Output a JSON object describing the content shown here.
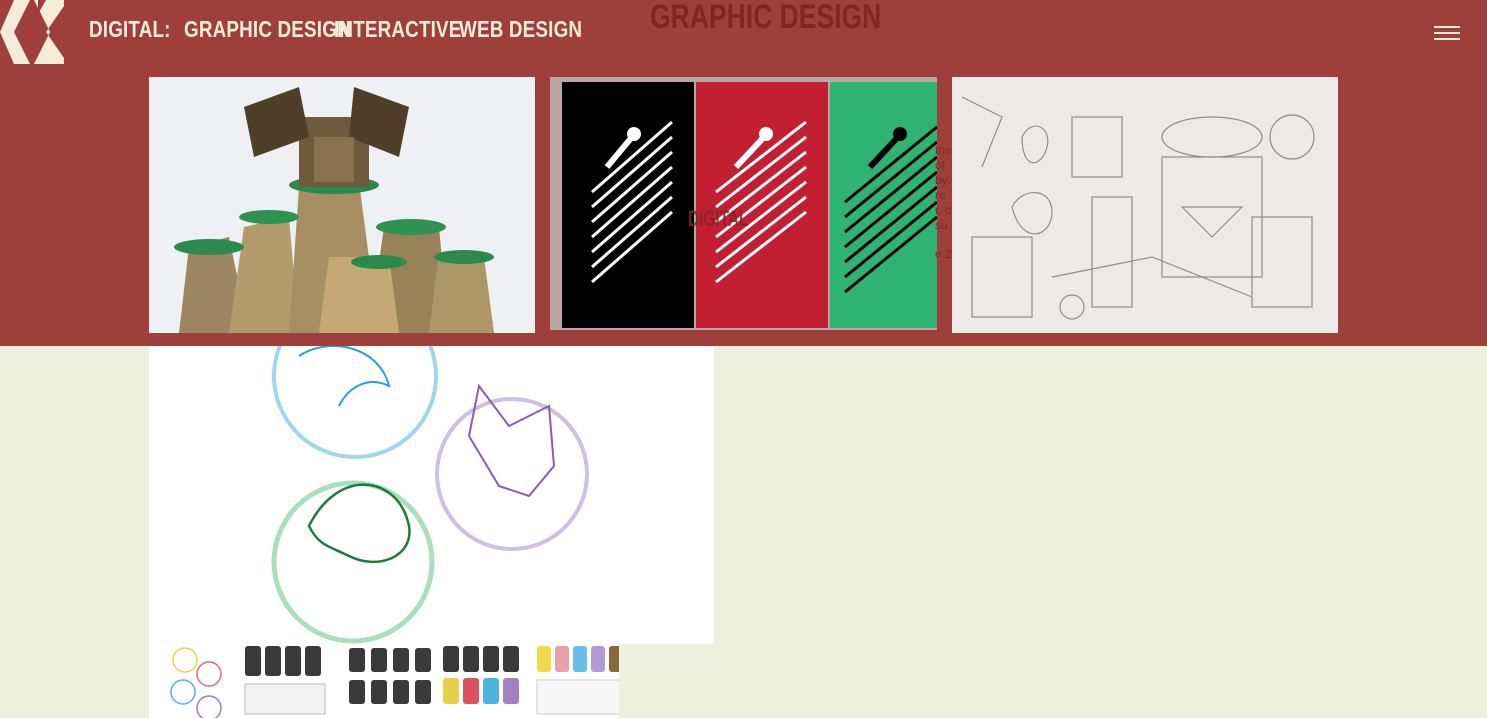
{
  "nav": {
    "section_label": "DIGITAL:",
    "items": [
      "GRAPHIC DESIGN",
      "INTERACTIVE",
      "WEB DESIGN"
    ]
  },
  "page": {
    "title": "GRAPHIC DESIGN"
  },
  "overlay": {
    "label": "DIGITAL",
    "fragments": [
      "the",
      "of",
      "by.",
      "re",
      "r, c",
      "su",
      "e 2"
    ]
  },
  "icons": {
    "logo": "kx-logo-icon",
    "menu": "hamburger-menu-icon"
  },
  "colors": {
    "header_bg": "#9e3f3b",
    "page_bg": "#edf0dd",
    "nav_text": "#f2ecd9",
    "title_text": "#7d2624"
  }
}
